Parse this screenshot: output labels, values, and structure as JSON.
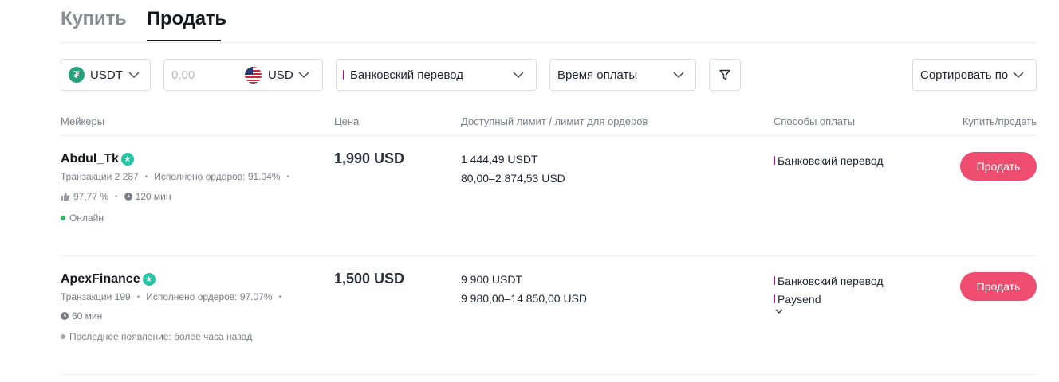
{
  "tabs": [
    {
      "label": "Купить",
      "active": false
    },
    {
      "label": "Продать",
      "active": true
    }
  ],
  "filters": {
    "crypto": {
      "value": "USDT",
      "icon": "tether-icon"
    },
    "amount": {
      "placeholder": "0,00",
      "currency": "USD",
      "icon": "us-flag-icon"
    },
    "payment_method": {
      "value": "Банковский перевод"
    },
    "payment_time": {
      "value": "Время оплаты"
    },
    "sort": {
      "value": "Сортировать по"
    }
  },
  "columns": {
    "makers": "Мейкеры",
    "price": "Цена",
    "limit": "Доступный лимит / лимит для ордеров",
    "methods": "Способы оплаты",
    "action": "Купить/продать"
  },
  "offers": [
    {
      "name": "Abdul_Tk",
      "transactions": "Транзакции 2 287",
      "completion": "Исполнено ордеров: 91.04%",
      "rating": "97,77 %",
      "pay_time": "120 мин",
      "status": "Онлайн",
      "status_color": "#2ebd60",
      "price": "1,990 USD",
      "available": "1 444,49 USDT",
      "order_limit": "80,00–2 874,53 USD",
      "methods": [
        "Банковский перевод"
      ],
      "action": "Продать"
    },
    {
      "name": "ApexFinance",
      "transactions": "Транзакции 199",
      "completion": "Исполнено ордеров: 97.07%",
      "pay_time": "60 мин",
      "status": "Последнее появление: более часа назад",
      "status_color": "#a7a9ae",
      "price": "1,500 USD",
      "available": "9 900 USDT",
      "order_limit": "9 980,00–14 850,00 USD",
      "methods": [
        "Банковский перевод",
        "Paysend"
      ],
      "action": "Продать"
    }
  ],
  "colors": {
    "accent": "#ee4d6f",
    "verified": "#27c4a5",
    "method_bar": "#8c1a7a"
  }
}
